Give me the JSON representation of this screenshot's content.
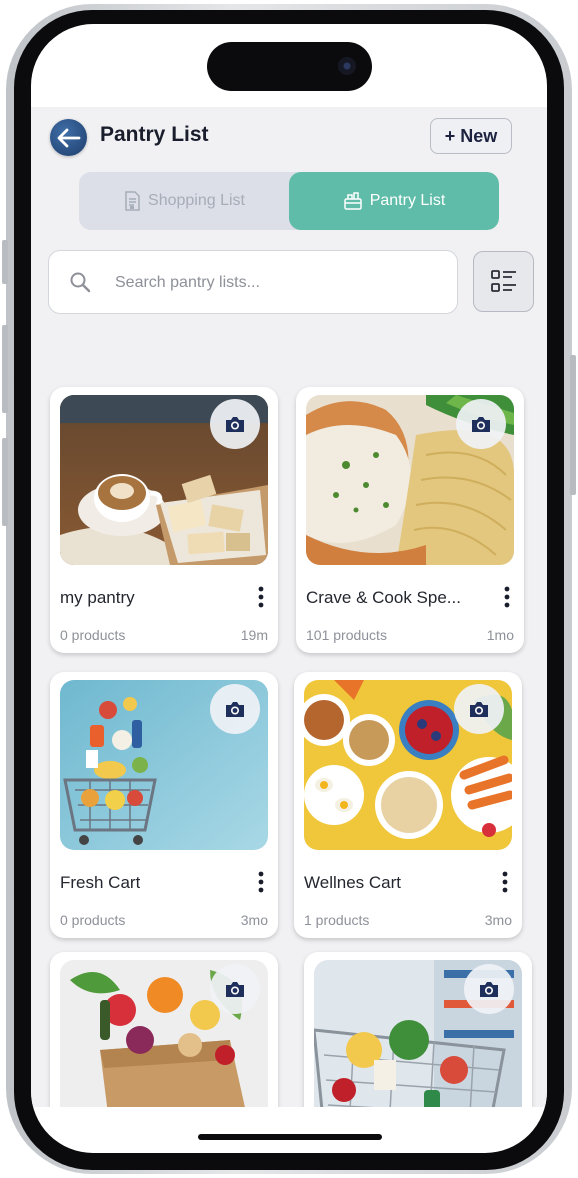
{
  "header": {
    "title": "Pantry List",
    "new_button_label": "+ New"
  },
  "tabs": [
    {
      "label": "Shopping List",
      "icon": "shopping-list-icon",
      "active": false
    },
    {
      "label": "Pantry List",
      "icon": "pantry-basket-icon",
      "active": true
    }
  ],
  "search": {
    "placeholder": "Search pantry lists...",
    "value": ""
  },
  "colors": {
    "accent": "#5fbca8",
    "back_button": "#2b5188",
    "background": "#f1f1f4",
    "title_text": "#1a1d2b"
  },
  "cards": [
    {
      "name": "my pantry",
      "count": "0 products",
      "time": "19m",
      "image": "coffee-and-pastry-photo"
    },
    {
      "name": "Crave & Cook Spe...",
      "count": "101 products",
      "time": "1mo",
      "image": "chicken-and-spaghetti-photo"
    },
    {
      "name": "Fresh Cart",
      "count": "0 products",
      "time": "3mo",
      "image": "flying-groceries-cart-photo"
    },
    {
      "name": "Wellnes Cart",
      "count": "1 products",
      "time": "3mo",
      "image": "healthy-food-bowls-photo"
    },
    {
      "name": "",
      "count": "",
      "time": "",
      "image": "grocery-bag-photo"
    },
    {
      "name": "",
      "count": "",
      "time": "",
      "image": "supermarket-trolley-photo"
    }
  ]
}
